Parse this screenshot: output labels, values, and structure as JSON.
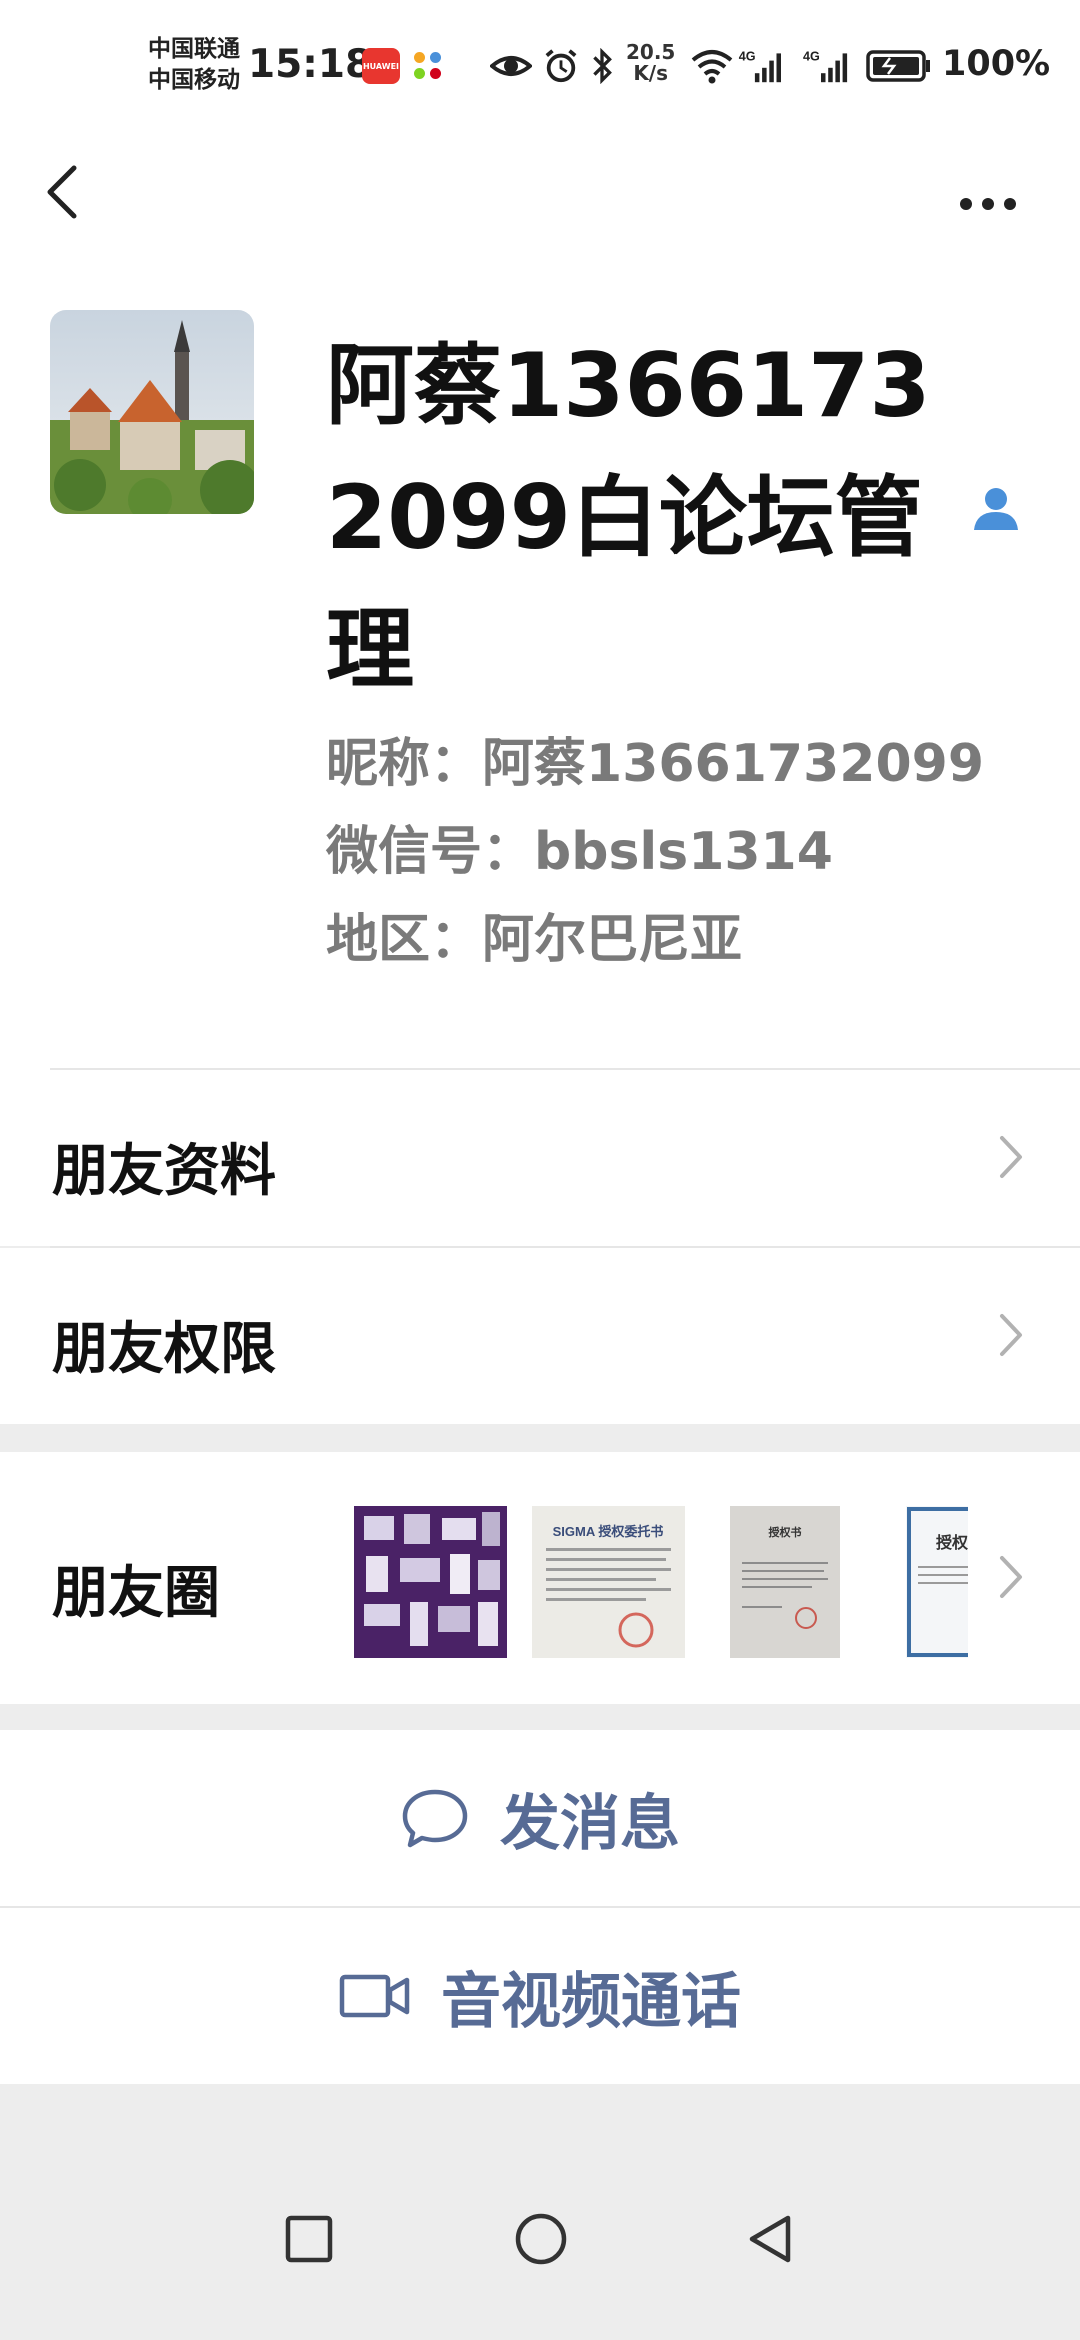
{
  "status_bar": {
    "carrier_1": "中国联通",
    "carrier_2": "中国移动",
    "time": "15:18",
    "huawei_badge": "HUAWEI",
    "net_speed_value": "20.5",
    "net_speed_unit": "K/s",
    "signal_1_label": "4G",
    "signal_2_label": "4G",
    "battery": "100%",
    "icons": [
      "eye-icon",
      "alarm-icon",
      "bluetooth-icon",
      "wifi-icon",
      "signal-icon",
      "battery-icon"
    ]
  },
  "nav": {
    "back_icon": "chevron-left-icon",
    "more_icon": "more-horizontal-icon"
  },
  "profile": {
    "remark_name": "阿蔡13661732099白论坛管理",
    "nickname_label": "昵称：",
    "nickname": "阿蔡13661732099",
    "wechat_id_label": "微信号：",
    "wechat_id": "bbsls1314",
    "region_label": "地区：",
    "region": "阿尔巴尼亚"
  },
  "list": {
    "friend_info": "朋友资料",
    "friend_permissions": "朋友权限",
    "moments": "朋友圈"
  },
  "moments_thumbs": {
    "thumb_2_title": "SIGMA 授权委托书",
    "thumb_3_title": "授权书",
    "thumb_4_title": "授权"
  },
  "actions": {
    "send_message": "发消息",
    "video_call": "音视频通话"
  },
  "colors": {
    "accent": "#576b95",
    "background": "#ededed",
    "card": "#ffffff",
    "contact_icon": "#4a90d9"
  }
}
